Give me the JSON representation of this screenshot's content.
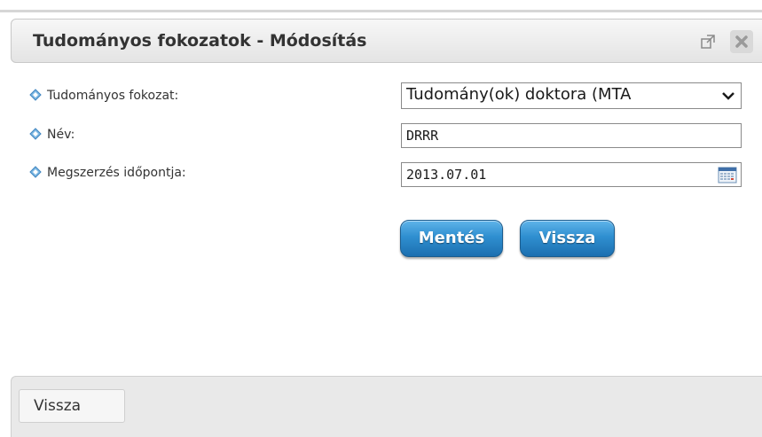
{
  "dialog": {
    "title": "Tudományos fokozatok - Módosítás",
    "popout_icon": "popout-icon",
    "close_icon": "close-icon"
  },
  "form": {
    "fields": [
      {
        "label": "Tudományos fokozat:",
        "type": "select",
        "value": "Tudomány(ok) doktora (MTA"
      },
      {
        "label": "Név:",
        "type": "text",
        "value": "DRRR"
      },
      {
        "label": "Megszerzés időpontja:",
        "type": "date",
        "value": "2013.07.01",
        "icon": "calendar-icon"
      }
    ],
    "save_label": "Mentés",
    "back_label": "Vissza"
  },
  "footer": {
    "back_label": "Vissza"
  },
  "colors": {
    "button_blue": "#2f8fd0",
    "bullet_blue": "#4a9ad4"
  }
}
